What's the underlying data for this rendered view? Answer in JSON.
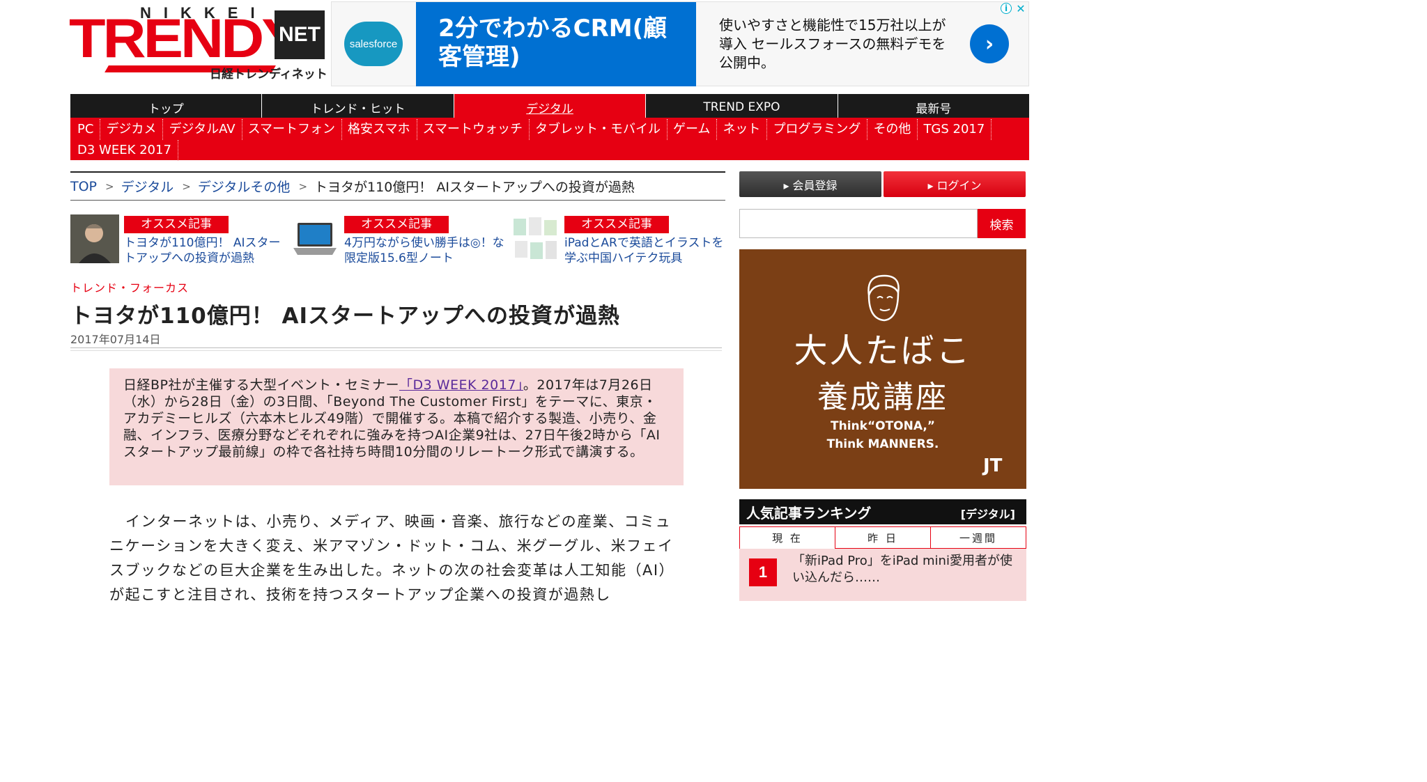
{
  "logo": {
    "nikkei": "NIKKEI",
    "trendy": "TRENDY",
    "net": "NET",
    "jp_name": "日経トレンディネット"
  },
  "top_ad": {
    "brand": "salesforce",
    "headline": "2分でわかるCRM(顧客管理)",
    "description": "使いやすさと機能性で15万社以上が導入 セールスフォースの無料デモを公開中。",
    "arrow": "›",
    "info": "i",
    "close": "✕"
  },
  "nav": {
    "tabs": [
      {
        "label": "トップ"
      },
      {
        "label": "トレンド・ヒット"
      },
      {
        "label": "デジタル"
      },
      {
        "label": "TREND EXPO"
      },
      {
        "label": "最新号"
      }
    ],
    "sub_items": [
      "PC",
      "デジカメ",
      "デジタルAV",
      "スマートフォン",
      "格安スマホ",
      "スマートウォッチ",
      "タブレット・モバイル",
      "ゲーム",
      "ネット",
      "プログラミング",
      "その他",
      "TGS 2017",
      "D3 WEEK 2017"
    ]
  },
  "breadcrumb": {
    "items": [
      "TOP",
      "デジタル",
      "デジタルその他"
    ],
    "separator": ">",
    "current": "トヨタが110億円！ AIスタートアップへの投資が過熱"
  },
  "recommended": [
    {
      "badge": "オススメ記事",
      "title": "トヨタが110億円！ AIスタートアップへの投資が過熱"
    },
    {
      "badge": "オススメ記事",
      "title": "4万円ながら使い勝手は◎！な限定版15.6型ノート"
    },
    {
      "badge": "オススメ記事",
      "title": "iPadとARで英語とイラストを学ぶ中国ハイテク玩具"
    }
  ],
  "article": {
    "category": "トレンド・フォーカス",
    "title": "トヨタが110億円！ AIスタートアップへの投資が過熱",
    "date": "2017年07月14日",
    "lead_before": "日経BP社が主催する大型イベント・セミナー",
    "lead_link": "「D3 WEEK 2017」",
    "lead_after": "。2017年は7月26日（水）から28日（金）の3日間、「Beyond The Customer First」をテーマに、東京・アカデミーヒルズ（六本木ヒルズ49階）で開催する。本稿で紹介する製造、小売り、金融、インフラ、医療分野などそれぞれに強みを持つAI企業9社は、27日午後2時から「AIスタートアップ最前線」の枠で各社持ち時間10分間のリレートーク形式で講演する。",
    "body": "インターネットは、小売り、メディア、映画・音楽、旅行などの産業、コミュニケーションを大きく変え、米アマゾン・ドット・コム、米グーグル、米フェイスブックなどの巨大企業を生み出した。ネットの次の社会変革は人工知能（AI）が起こすと注目され、技術を持つスタートアップ企業への投資が過熱し"
  },
  "sidebar": {
    "register_label": "▸ 会員登録",
    "login_label": "▸ ログイン",
    "search_placeholder": "",
    "search_label": "検索",
    "ad": {
      "line1": "大人たばこ",
      "line2": "養成講座",
      "sub1": "Think“OTONA,”",
      "sub2": "Think MANNERS.",
      "brand": "JT"
    },
    "ranking": {
      "title": "人気記事ランキング",
      "category": "[デジタル]",
      "tabs": [
        "現 在",
        "昨 日",
        "一週間"
      ],
      "items": [
        {
          "rank": "1",
          "title": "「新iPad Pro」をiPad mini愛用者が使い込んだら……"
        }
      ]
    }
  },
  "colors": {
    "brand_red": "#e60012",
    "nav_black": "#1a1a1a",
    "link_blue": "#1a4a9a",
    "lead_pink": "#f7d9da",
    "ad_brown": "#7b3f15",
    "salesforce_blue": "#0070d2"
  }
}
